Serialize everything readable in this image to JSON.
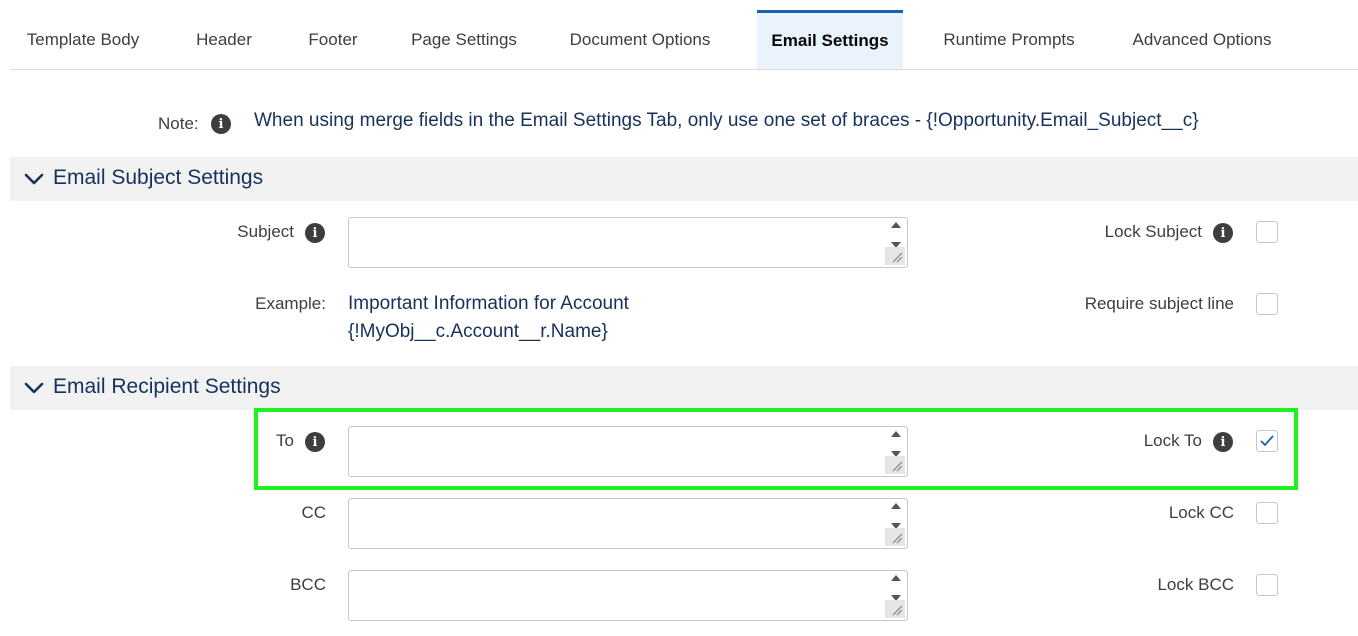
{
  "tabs": [
    {
      "label": "Template Body",
      "active": false
    },
    {
      "label": "Header",
      "active": false
    },
    {
      "label": "Footer",
      "active": false
    },
    {
      "label": "Page Settings",
      "active": false
    },
    {
      "label": "Document Options",
      "active": false
    },
    {
      "label": "Email Settings",
      "active": true
    },
    {
      "label": "Runtime Prompts",
      "active": false
    },
    {
      "label": "Advanced Options",
      "active": false
    }
  ],
  "note": {
    "label": "Note:",
    "text": "When using merge fields in the Email Settings Tab, only use one set of braces - {!Opportunity.Email_Subject__c}"
  },
  "sections": {
    "subject": {
      "title": "Email Subject Settings"
    },
    "recipient": {
      "title": "Email Recipient Settings"
    }
  },
  "subject_settings": {
    "subject_label": "Subject",
    "subject_value": "",
    "lock_subject_label": "Lock Subject",
    "lock_subject_checked": false,
    "example_label": "Example:",
    "example_line1": "Important Information for Account",
    "example_line2": "{!MyObj__c.Account__r.Name}",
    "require_subject_label": "Require subject line",
    "require_subject_checked": false
  },
  "recipient_settings": {
    "to_label": "To",
    "to_value": "",
    "lock_to_label": "Lock To",
    "lock_to_checked": true,
    "cc_label": "CC",
    "cc_value": "",
    "lock_cc_label": "Lock CC",
    "lock_cc_checked": false,
    "bcc_label": "BCC",
    "bcc_value": "",
    "lock_bcc_label": "Lock BCC",
    "lock_bcc_checked": false
  },
  "icons": {
    "info": "info-icon",
    "chevron": "chevron-down-icon",
    "check": "checkmark-icon"
  },
  "colors": {
    "active_tab_border": "#1b5eb5",
    "active_tab_bg": "#eaf2fb",
    "section_bg": "#f3f2f2",
    "text_navy": "#16325c",
    "highlight_box": "#1ff01f",
    "check": "#1b5eb5"
  }
}
